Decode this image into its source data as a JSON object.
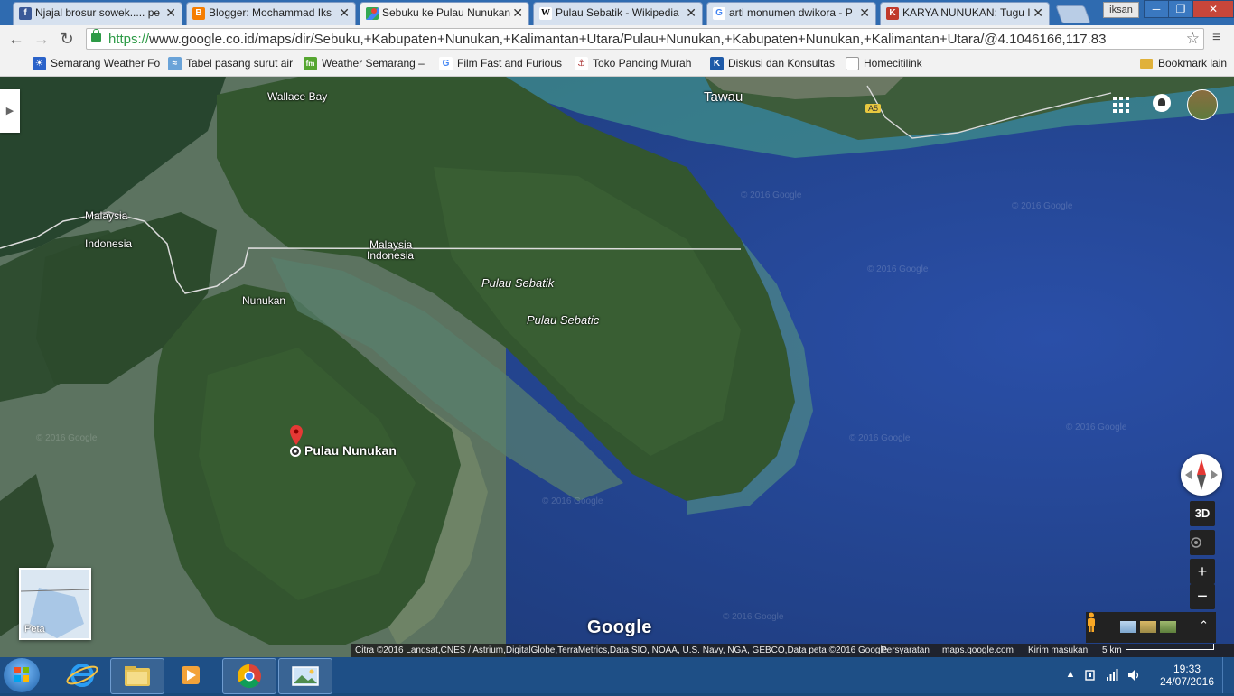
{
  "tabs": [
    {
      "title": "Njajal brosur sowek..... pe",
      "favicon": "facebook-icon",
      "color": "#3b5998",
      "glyph": "f"
    },
    {
      "title": "Blogger: Mochammad Iks",
      "favicon": "blogger-icon",
      "color": "#f57d00",
      "glyph": "B"
    },
    {
      "title": "Sebuku ke Pulau Nunukan",
      "favicon": "google-maps-icon",
      "color": "#34a853",
      "glyph": "",
      "active": true
    },
    {
      "title": "Pulau Sebatik - Wikipedia",
      "favicon": "wikipedia-icon",
      "color": "#ffffff",
      "glyph": "W"
    },
    {
      "title": "arti monumen dwikora - P",
      "favicon": "google-icon",
      "color": "#ffffff",
      "glyph": "G"
    },
    {
      "title": "KARYA NUNUKAN: Tugu I",
      "favicon": "blog-logo-icon",
      "color": "#c0392b",
      "glyph": "K"
    }
  ],
  "window": {
    "user": "iksan",
    "minimize": "─",
    "restore": "❐",
    "close": "✕"
  },
  "address": {
    "scheme": "https://",
    "rest": "www.google.co.id/maps/dir/Sebuku,+Kabupaten+Nunukan,+Kalimantan+Utara/Pulau+Nunukan,+Kabupaten+Nunukan,+Kalimantan+Utara/@4.1046166,117.83"
  },
  "bookmarks": [
    {
      "label": "Semarang Weather Fo",
      "icon": "weather-icon",
      "color": "#2a62c9",
      "glyph": "☀"
    },
    {
      "label": "Tabel pasang surut air",
      "icon": "tide-icon",
      "color": "#6aa3d8",
      "glyph": "≈"
    },
    {
      "label": "Weather Semarang –",
      "icon": "fm-icon",
      "color": "#55a630",
      "glyph": "fm"
    },
    {
      "label": "Film Fast and Furious",
      "icon": "google-icon",
      "color": "#ffffff",
      "glyph": "G"
    },
    {
      "label": "Toko Pancing Murah",
      "icon": "fishing-icon",
      "color": "#ffffff",
      "glyph": "⚓"
    },
    {
      "label": "Diskusi dan Konsultas",
      "icon": "kaskus-icon",
      "color": "#1e5aa8",
      "glyph": "K"
    },
    {
      "label": "Homecitilink",
      "icon": "page-icon",
      "color": "#ffffff",
      "glyph": "▯"
    }
  ],
  "bookmark_other": "Bookmark lain",
  "map": {
    "labels": {
      "tawau": "Tawau",
      "wallace_bay": "Wallace Bay",
      "malaysia_1": "Malaysia",
      "indonesia_1": "Indonesia",
      "malaysia_2": "Malaysia",
      "indonesia_2": "Indonesia",
      "nunukan": "Nunukan",
      "pulau_sebatik": "Pulau Sebatik",
      "pulau_sebatic": "Pulau Sebatic",
      "pulau_nunukan": "Pulau Nunukan",
      "road_a5": "A5"
    },
    "watermark": "© 2016 Google",
    "controls": {
      "three_d": "3D",
      "zoom_in": "+",
      "zoom_out": "−",
      "expand": "⌃"
    },
    "minimap_label": "Peta",
    "google_logo": "Google",
    "attribution": {
      "data": "Citra ©2016 Landsat,CNES / Astrium,DigitalGlobe,TerraMetrics,Data SIO, NOAA, U.S. Navy, NGA, GEBCO,Data peta ©2016 Google",
      "terms": "Persyaratan",
      "site": "maps.google.com",
      "feedback": "Kirim masukan",
      "scale": "5 km"
    }
  },
  "taskbar": {
    "time": "19:33",
    "date": "24/07/2016",
    "tray_up": "▲"
  }
}
